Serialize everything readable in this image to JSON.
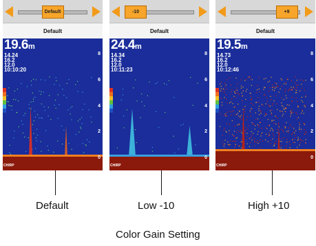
{
  "panels": [
    {
      "slider_label": "Default",
      "slider_position": 0.5,
      "setting_name": "Default",
      "depth_value": "19.6",
      "depth_unit": "m",
      "readout_1": "14.24",
      "readout_2": "16.2",
      "readout_3": "12.0",
      "clock": "10:10:20",
      "caption": "Default",
      "level": 0
    },
    {
      "slider_label": "-10",
      "slider_position": 0.0,
      "setting_name": "Default",
      "depth_value": "24.4",
      "depth_unit": "m",
      "readout_1": "14.34",
      "readout_2": "16.2",
      "readout_3": "12.0",
      "clock": "10:11:23",
      "caption": "Low -10",
      "level": -10
    },
    {
      "slider_label": "+9",
      "slider_position": 0.95,
      "setting_name": "Default",
      "depth_value": "19.5",
      "depth_unit": "m",
      "readout_1": "14.73",
      "readout_2": "16.2",
      "readout_3": "12.0",
      "clock": "10:12:46",
      "caption": "High +10",
      "level": 10
    }
  ],
  "depth_scale": [
    "8",
    "6",
    "4",
    "2",
    "0"
  ],
  "chirp_label": "CHIRP",
  "figure_title": "Color Gain Setting",
  "colors": {
    "water": "#1a2d9a",
    "bottom": "#8c1a0c",
    "slider_thumb": "#f7a52b",
    "arrow": "#f29b1a"
  }
}
